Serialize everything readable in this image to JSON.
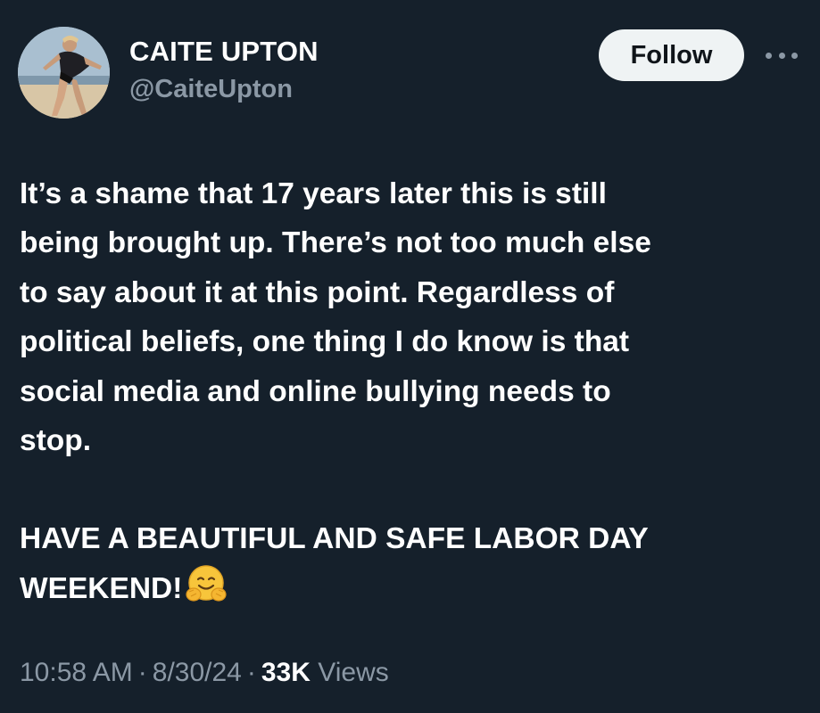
{
  "author": {
    "display_name": "CAITE UPTON",
    "handle": "@CaiteUpton"
  },
  "actions": {
    "follow_label": "Follow",
    "more_icon": "more-horizontal-icon"
  },
  "tweet": {
    "paragraph_1": "It’s a shame that 17 years later this is still\nbeing brought up. There’s not too much else\nto say about it at this point. Regardless of\npolitical beliefs, one thing I do know is that\nsocial media and online bullying needs to\nstop.",
    "paragraph_2": "HAVE A BEAUTIFUL AND SAFE LABOR DAY\nWEEKEND!",
    "emoji": "hugging-face-emoji"
  },
  "meta": {
    "time": "10:58 AM",
    "separator": "·",
    "date": "8/30/24",
    "views_count": "33K",
    "views_label": "Views"
  },
  "colors": {
    "background": "#15202b",
    "text": "#ffffff",
    "secondary_text": "#8b98a5",
    "follow_button_bg": "#eff3f4",
    "follow_button_text": "#0f1419"
  }
}
